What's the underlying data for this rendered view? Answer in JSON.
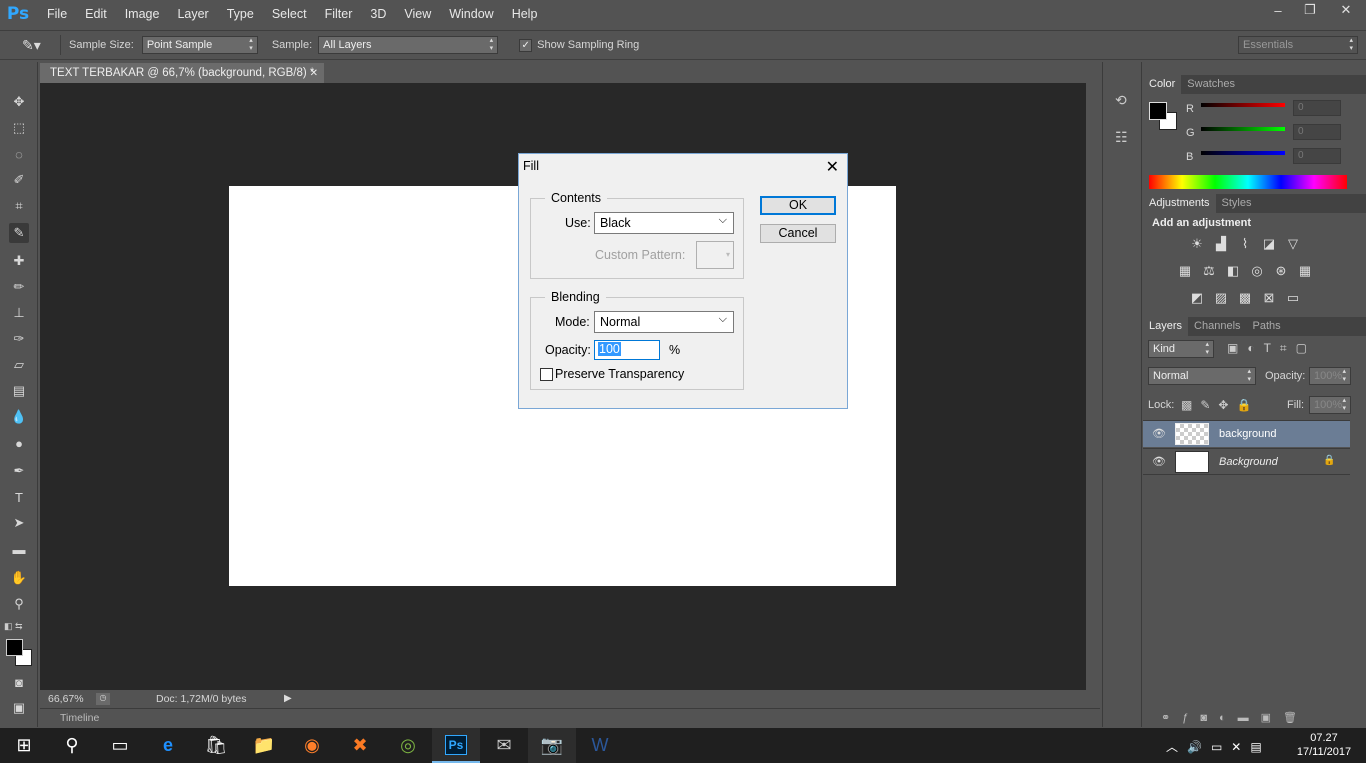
{
  "app": {
    "logo": "Ps",
    "menus": [
      "File",
      "Edit",
      "Image",
      "Layer",
      "Type",
      "Select",
      "Filter",
      "3D",
      "View",
      "Window",
      "Help"
    ],
    "win_controls": [
      "–",
      "❐",
      "✕"
    ]
  },
  "options": {
    "sample_size_label": "Sample Size:",
    "sample_size_value": "Point Sample",
    "sample_label": "Sample:",
    "sample_value": "All Layers",
    "ring_label": "Show Sampling Ring",
    "workspace": "Essentials"
  },
  "document": {
    "tab_title": "TEXT TERBAKAR @ 66,7% (background, RGB/8) *",
    "zoom": "66,67%",
    "doc_info": "Doc: 1,72M/0 bytes",
    "timeline": "Timeline"
  },
  "color_panel": {
    "tabs": [
      "Color",
      "Swatches"
    ],
    "channels": [
      {
        "label": "R",
        "value": "0"
      },
      {
        "label": "G",
        "value": "0"
      },
      {
        "label": "B",
        "value": "0"
      }
    ]
  },
  "adjustments_panel": {
    "tabs": [
      "Adjustments",
      "Styles"
    ],
    "heading": "Add an adjustment"
  },
  "layers_panel": {
    "tabs": [
      "Layers",
      "Channels",
      "Paths"
    ],
    "filter": "Kind",
    "blend_mode": "Normal",
    "opacity_label": "Opacity:",
    "opacity_value": "100%",
    "lock_label": "Lock:",
    "fill_label": "Fill:",
    "fill_value": "100%",
    "layers": [
      {
        "name": "background"
      },
      {
        "name": "Background"
      }
    ]
  },
  "fill_dialog": {
    "title": "Fill",
    "contents_legend": "Contents",
    "use_label": "Use:",
    "use_value": "Black",
    "custom_pattern_label": "Custom Pattern:",
    "blending_legend": "Blending",
    "mode_label": "Mode:",
    "mode_value": "Normal",
    "opacity_label": "Opacity:",
    "opacity_value": "100",
    "percent": "%",
    "preserve_label": "Preserve Transparency",
    "ok": "OK",
    "cancel": "Cancel"
  },
  "taskbar": {
    "time": "07.27",
    "date": "17/11/2017"
  }
}
